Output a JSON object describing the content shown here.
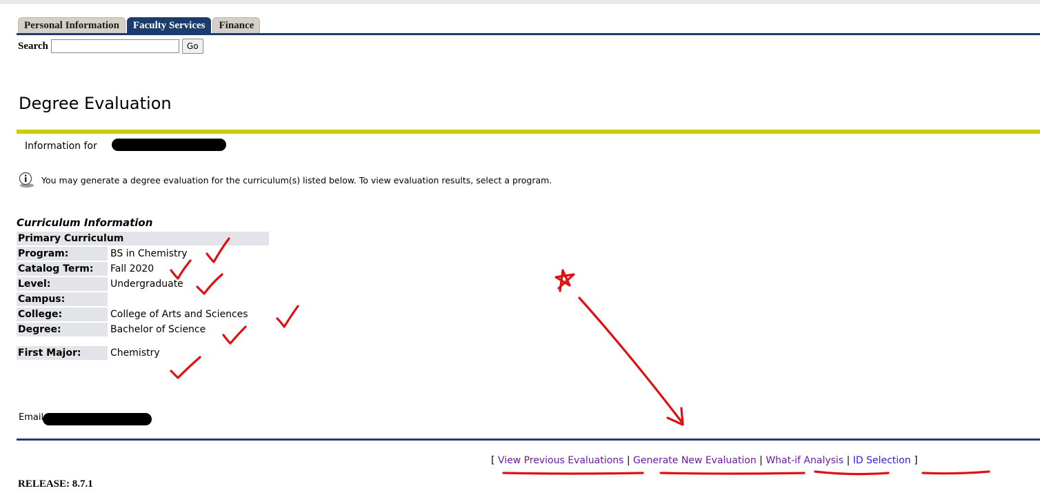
{
  "tabs": [
    {
      "label": "Personal Information",
      "active": false
    },
    {
      "label": "Faculty Services",
      "active": true
    },
    {
      "label": "Finance",
      "active": false
    }
  ],
  "search": {
    "label": "Search",
    "value": "",
    "go_label": "Go"
  },
  "page_title": "Degree Evaluation",
  "info_for_label": "Information for",
  "info_message": "You may generate a degree evaluation for the curriculum(s) listed below. To view evaluation results, select a program.",
  "curriculum": {
    "caption": "Curriculum Information",
    "primary_header": "Primary Curriculum",
    "rows": [
      {
        "label": "Program:",
        "value": "BS in Chemistry"
      },
      {
        "label": "Catalog Term:",
        "value": "Fall 2020"
      },
      {
        "label": "Level:",
        "value": "Undergraduate"
      },
      {
        "label": "Campus:",
        "value": ""
      },
      {
        "label": "College:",
        "value": "College of Arts and Sciences"
      },
      {
        "label": "Degree:",
        "value": "Bachelor of Science"
      }
    ],
    "major_label": "First Major:",
    "major_value": "Chemistry"
  },
  "email_label": "Email",
  "links": {
    "open_bracket": "[",
    "close_bracket": "]",
    "separator": "|",
    "view_previous": "View Previous Evaluations",
    "generate_new": "Generate New Evaluation",
    "what_if": "What-if Analysis",
    "id_selection": "ID Selection"
  },
  "release": "RELEASE: 8.7.1",
  "colors": {
    "navy": "#1c3d6b",
    "yellow_rule": "#cccc00",
    "annotation_red": "#e01010",
    "link": "#2b1ce0",
    "visited_link": "#6a1aa8"
  }
}
